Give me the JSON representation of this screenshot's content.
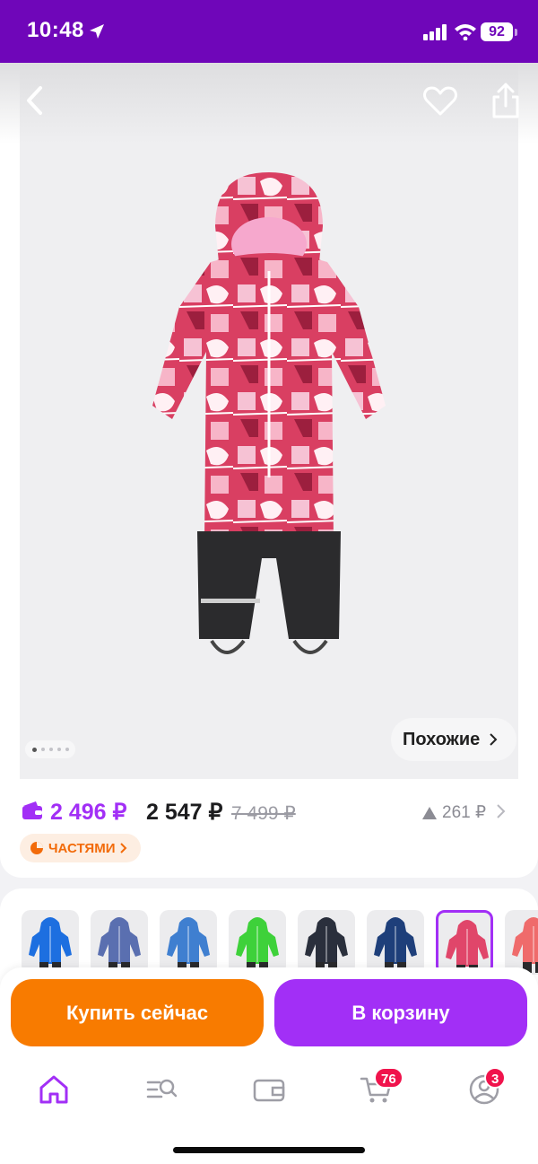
{
  "status_bar": {
    "time": "10:48",
    "battery": "92",
    "icons": [
      "location-arrow-icon",
      "signal-icon",
      "wifi-icon",
      "battery-icon"
    ]
  },
  "header": {
    "icons": [
      "chevron-left-icon",
      "heart-icon",
      "share-icon"
    ]
  },
  "gallery": {
    "pages_total": 5,
    "current_page": 1,
    "similar_label": "Похожие"
  },
  "price": {
    "wallet_price": "2 496 ₽",
    "regular_price": "2 547 ₽",
    "old_price": "7 499 ₽",
    "price_change": "261 ₽",
    "installment_label": "ЧАСТЯМИ"
  },
  "variants": [
    {
      "color": "#1d6fe0",
      "pattern": "solid",
      "selected": false
    },
    {
      "color": "#5a6fb0",
      "pattern": "print-navy",
      "selected": false
    },
    {
      "color": "#3f7fd0",
      "pattern": "print-blue",
      "selected": false
    },
    {
      "color": "#3ed13a",
      "pattern": "solid",
      "selected": false
    },
    {
      "color": "#2a2f3c",
      "pattern": "print-dark",
      "selected": false
    },
    {
      "color": "#1e3f7a",
      "pattern": "solid-navy",
      "selected": false
    },
    {
      "color": "#e0466a",
      "pattern": "print-pink",
      "selected": true
    },
    {
      "color": "#ef6b6b",
      "pattern": "print-coral",
      "selected": false
    }
  ],
  "actions": {
    "buy_now": "Купить сейчас",
    "add_to_cart": "В корзину"
  },
  "tab_bar": {
    "items": [
      {
        "icon": "home-icon",
        "active": true,
        "badge": ""
      },
      {
        "icon": "catalog-search-icon",
        "active": false,
        "badge": ""
      },
      {
        "icon": "wallet-icon",
        "active": false,
        "badge": ""
      },
      {
        "icon": "cart-icon",
        "active": false,
        "badge": "76"
      },
      {
        "icon": "profile-icon",
        "active": false,
        "badge": "3"
      }
    ]
  },
  "colors": {
    "brand_purple": "#a22ff6",
    "status_bar": "#6f06b9",
    "buy_orange": "#f87b00",
    "badge_red": "#f0134c"
  }
}
